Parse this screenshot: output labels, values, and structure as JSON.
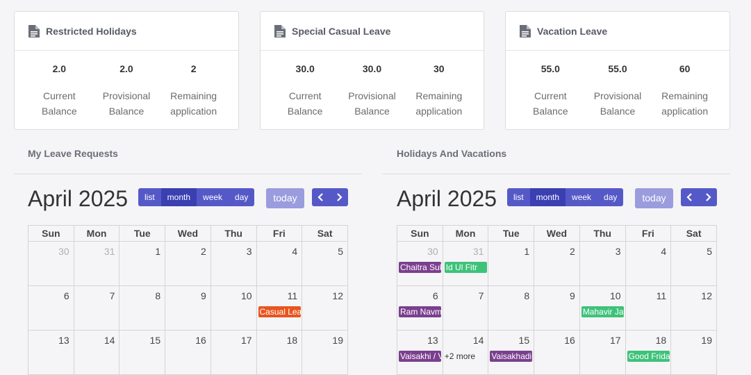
{
  "cards": [
    {
      "title": "Restricted Holidays",
      "stats": [
        {
          "value": "2.0",
          "label1": "Current",
          "label2": "Balance"
        },
        {
          "value": "2.0",
          "label1": "Provisional",
          "label2": "Balance"
        },
        {
          "value": "2",
          "label1": "Remaining",
          "label2": "application"
        }
      ]
    },
    {
      "title": "Special Casual Leave",
      "stats": [
        {
          "value": "30.0",
          "label1": "Current",
          "label2": "Balance"
        },
        {
          "value": "30.0",
          "label1": "Provisional",
          "label2": "Balance"
        },
        {
          "value": "30",
          "label1": "Remaining",
          "label2": "application"
        }
      ]
    },
    {
      "title": "Vacation Leave",
      "stats": [
        {
          "value": "55.0",
          "label1": "Current",
          "label2": "Balance"
        },
        {
          "value": "55.0",
          "label1": "Provisional",
          "label2": "Balance"
        },
        {
          "value": "60",
          "label1": "Remaining",
          "label2": "application"
        }
      ]
    }
  ],
  "panels": [
    {
      "title": "My Leave Requests",
      "month": "April 2025",
      "views": [
        "list",
        "month",
        "week",
        "day"
      ],
      "today": "today",
      "weekdays": [
        "Sun",
        "Mon",
        "Tue",
        "Wed",
        "Thu",
        "Fri",
        "Sat"
      ],
      "weeks": [
        [
          "30",
          "31",
          "1",
          "2",
          "3",
          "4",
          "5"
        ],
        [
          "6",
          "7",
          "8",
          "9",
          "10",
          "11",
          "12"
        ],
        [
          "13",
          "14",
          "15",
          "16",
          "17",
          "18",
          "19"
        ]
      ],
      "events": [
        {
          "week": 1,
          "day": 5,
          "text": "Casual Leave",
          "color": "#e8551f"
        }
      ],
      "more": []
    },
    {
      "title": "Holidays And Vacations",
      "month": "April 2025",
      "views": [
        "list",
        "month",
        "week",
        "day"
      ],
      "today": "today",
      "weekdays": [
        "Sun",
        "Mon",
        "Tue",
        "Wed",
        "Thu",
        "Fri",
        "Sat"
      ],
      "weeks": [
        [
          "30",
          "31",
          "1",
          "2",
          "3",
          "4",
          "5"
        ],
        [
          "6",
          "7",
          "8",
          "9",
          "10",
          "11",
          "12"
        ],
        [
          "13",
          "14",
          "15",
          "16",
          "17",
          "18",
          "19"
        ]
      ],
      "events": [
        {
          "week": 0,
          "day": 0,
          "text": "Chaitra Sukladi",
          "color": "#7b3f8f"
        },
        {
          "week": 0,
          "day": 1,
          "text": "Id Ul Fitr",
          "color": "#3ec27a"
        },
        {
          "week": 1,
          "day": 0,
          "text": "Ram Navmi",
          "color": "#7b3f8f"
        },
        {
          "week": 1,
          "day": 4,
          "text": "Mahavir Jayanti",
          "color": "#3ec27a"
        },
        {
          "week": 2,
          "day": 0,
          "text": "Vaisakhi / Vishu",
          "color": "#7b3f8f"
        },
        {
          "week": 2,
          "day": 2,
          "text": "Vaisakhadi",
          "color": "#7b3f8f"
        },
        {
          "week": 2,
          "day": 5,
          "text": "Good Friday",
          "color": "#3ec27a"
        }
      ],
      "more": [
        {
          "week": 2,
          "day": 1,
          "text": "+2 more"
        }
      ]
    }
  ],
  "colors": {
    "primary": "#5559c7",
    "primary_active": "#3a3fb2",
    "today_disabled": "#9a9cde"
  },
  "icons": {
    "card": "document-icon",
    "prev": "chevron-left-icon",
    "next": "chevron-right-icon"
  }
}
